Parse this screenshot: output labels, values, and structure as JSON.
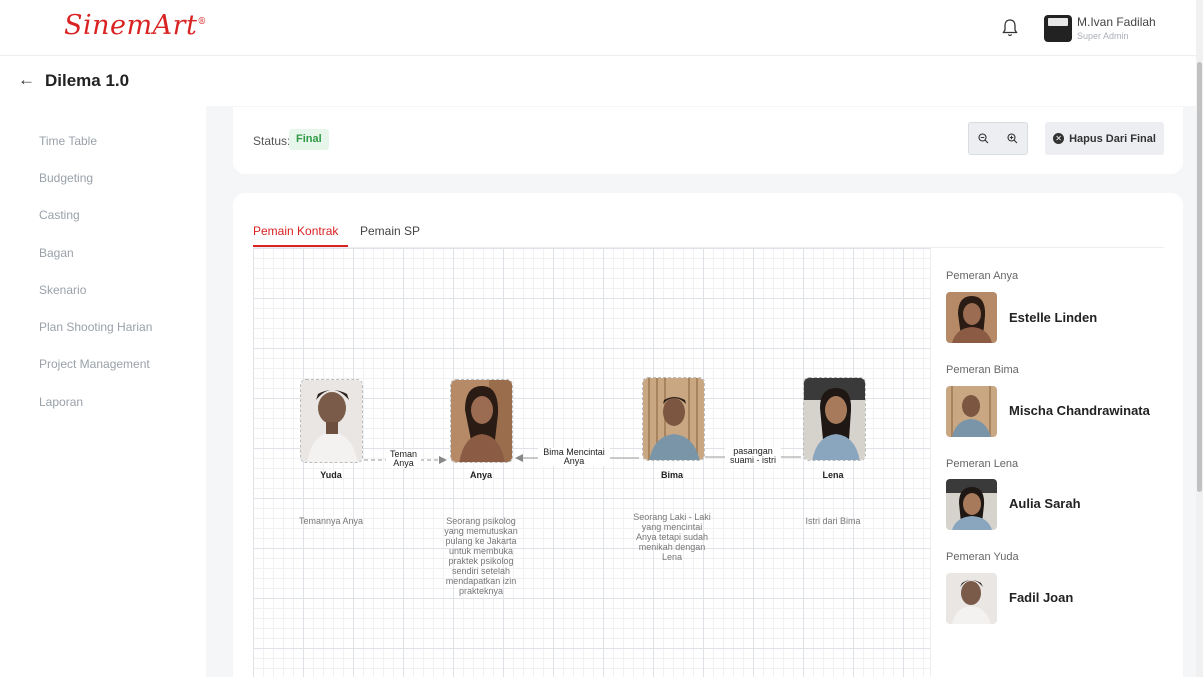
{
  "brand": {
    "logo_text": "SinemArt",
    "logo_mark": "®",
    "color": "#d92323"
  },
  "user": {
    "name": "M.Ivan Fadilah",
    "role": "Super Admin"
  },
  "page": {
    "title": "Dilema 1.0"
  },
  "sidebar": {
    "items": [
      {
        "label": "Time Table"
      },
      {
        "label": "Budgeting"
      },
      {
        "label": "Casting"
      },
      {
        "label": "Bagan"
      },
      {
        "label": "Skenario"
      },
      {
        "label": "Plan Shooting Harian"
      },
      {
        "label": "Project Management"
      },
      {
        "label": "Laporan"
      }
    ]
  },
  "status": {
    "label": "Status:",
    "value": "Final",
    "color": "#2e9a45"
  },
  "toolbar": {
    "hapus_label": "Hapus Dari Final"
  },
  "tabs": [
    {
      "label": "Pemain Kontrak",
      "active": true
    },
    {
      "label": "Pemain SP",
      "active": false
    }
  ],
  "diagram": {
    "nodes": [
      {
        "name": "Yuda",
        "description": "Temannya Anya"
      },
      {
        "name": "Anya",
        "description": "Seorang psikolog yang memutuskan pulang ke Jakarta untuk membuka praktek psikolog sendiri setelah mendapatkan izin prakteknya"
      },
      {
        "name": "Bima",
        "description": "Seorang Laki - Laki yang mencintai Anya tetapi sudah menikah dengan Lena"
      },
      {
        "name": "Lena",
        "description": "Istri dari Bima"
      }
    ],
    "edges": [
      {
        "from": "Yuda",
        "to": "Anya",
        "label_1": "Teman",
        "label_2": "Anya",
        "style": "dashed"
      },
      {
        "from": "Bima",
        "to": "Anya",
        "label_1": "Bima Mencintai",
        "label_2": "Anya",
        "style": "solid"
      },
      {
        "from": "Bima",
        "to": "Lena",
        "label_1": "pasangan",
        "label_2": "suami - istri",
        "style": "solid"
      }
    ]
  },
  "cast": [
    {
      "role": "Pemeran Anya",
      "actor": "Estelle Linden"
    },
    {
      "role": "Pemeran Bima",
      "actor": "Mischa Chandrawinata"
    },
    {
      "role": "Pemeran Lena",
      "actor": "Aulia Sarah"
    },
    {
      "role": "Pemeran Yuda",
      "actor": "Fadil Joan"
    }
  ]
}
